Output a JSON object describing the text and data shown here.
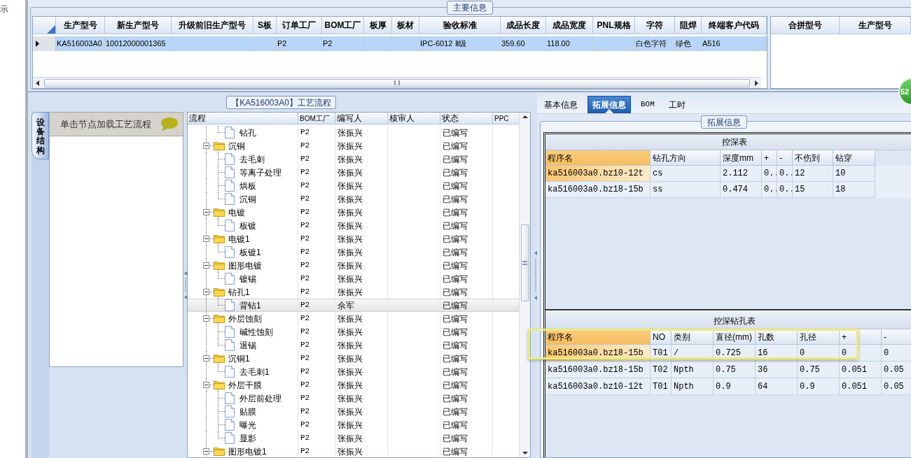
{
  "edge_text": "示",
  "main_info": {
    "legend": "主要信息",
    "columns": [
      "生产型号",
      "新生产型号",
      "升级前旧生产型号",
      "S板",
      "订单工厂",
      "BOM工厂",
      "板厚",
      "板材",
      "验收标准",
      "成品长度",
      "成品宽度",
      "PNL规格",
      "字符",
      "阻焊",
      "终端客户代码"
    ],
    "rows": [
      {
        "selected": true,
        "cells": [
          "KA516003A0",
          "10012000001365",
          null,
          null,
          "P2",
          "P2",
          null,
          null,
          "IPC-6012 Ⅱ级",
          "359.60",
          "118.00",
          null,
          "白色字符",
          "绿色",
          "A516"
        ]
      }
    ]
  },
  "merge_grid": {
    "columns": [
      "合拼型号",
      "生产型号"
    ]
  },
  "badge": "52",
  "flow_panel": {
    "legend": "【KA516003A0】工艺流程",
    "side_tab": "设备结构",
    "hint": "单击节点加载工艺流程",
    "columns": [
      "流程",
      "BOM工厂",
      "编写人",
      "核审人",
      "状态",
      "PPC"
    ],
    "nodes": [
      {
        "children": [
          {
            "kind": "file",
            "label": "钻孔",
            "bom": "P2",
            "author": "张振兴",
            "status": "已编写",
            "selected": false
          }
        ]
      },
      {
        "kind": "folder",
        "label": "沉铜",
        "bom": "P2",
        "author": "张振兴",
        "status": "已编写",
        "expanded": true,
        "selected": false,
        "children": [
          {
            "kind": "file",
            "label": "去毛刺",
            "bom": "P2",
            "author": "张振兴",
            "status": "已编写",
            "selected": false
          },
          {
            "kind": "file",
            "label": "等离子处理",
            "bom": "P2",
            "author": "张振兴",
            "status": "已编写",
            "selected": false
          },
          {
            "kind": "file",
            "label": "烘板",
            "bom": "P2",
            "author": "张振兴",
            "status": "已编写",
            "selected": false
          },
          {
            "kind": "file",
            "label": "沉铜",
            "bom": "P2",
            "author": "张振兴",
            "status": "已编写",
            "selected": false
          }
        ]
      },
      {
        "kind": "folder",
        "label": "电镀",
        "bom": "P2",
        "author": "张振兴",
        "status": "已编写",
        "expanded": true,
        "selected": false,
        "children": [
          {
            "kind": "file",
            "label": "板镀",
            "bom": "P2",
            "author": "张振兴",
            "status": "已编写",
            "selected": false
          }
        ]
      },
      {
        "kind": "folder",
        "label": "电镀1",
        "bom": "P2",
        "author": "张振兴",
        "status": "已编写",
        "expanded": true,
        "selected": false,
        "children": [
          {
            "kind": "file",
            "label": "板镀1",
            "bom": "P2",
            "author": "张振兴",
            "status": "已编写",
            "selected": false
          }
        ]
      },
      {
        "kind": "folder",
        "label": "图形电镀",
        "bom": "P2",
        "author": "张振兴",
        "status": "已编写",
        "expanded": true,
        "selected": false,
        "children": [
          {
            "kind": "file",
            "label": "镀锡",
            "bom": "P2",
            "author": "张振兴",
            "status": "已编写",
            "selected": false
          }
        ]
      },
      {
        "kind": "folder",
        "label": "钻孔1",
        "bom": "P2",
        "author": "张振兴",
        "status": "已编写",
        "expanded": true,
        "selected": false,
        "children": [
          {
            "kind": "file",
            "label": "背钻1",
            "bom": "P2",
            "author": "佘军",
            "status": "已编写",
            "selected": true
          }
        ]
      },
      {
        "kind": "folder",
        "label": "外层蚀刻",
        "bom": "P2",
        "author": "张振兴",
        "status": "已编写",
        "expanded": true,
        "selected": false,
        "children": [
          {
            "kind": "file",
            "label": "碱性蚀刻",
            "bom": "P2",
            "author": "张振兴",
            "status": "已编写",
            "selected": false
          },
          {
            "kind": "file",
            "label": "退锡",
            "bom": "P2",
            "author": "张振兴",
            "status": "已编写",
            "selected": false
          }
        ]
      },
      {
        "kind": "folder",
        "label": "沉铜1",
        "bom": "P2",
        "author": "张振兴",
        "status": "已编写",
        "expanded": true,
        "selected": false,
        "children": [
          {
            "kind": "file",
            "label": "去毛刺1",
            "bom": "P2",
            "author": "张振兴",
            "status": "已编写",
            "selected": false
          }
        ]
      },
      {
        "kind": "folder",
        "label": "外层干膜",
        "bom": "P2",
        "author": "张振兴",
        "status": "已编写",
        "expanded": true,
        "selected": false,
        "children": [
          {
            "kind": "file",
            "label": "外层前处理",
            "bom": "P2",
            "author": "张振兴",
            "status": "已编写",
            "selected": false
          },
          {
            "kind": "file",
            "label": "贴膜",
            "bom": "P2",
            "author": "张振兴",
            "status": "已编写",
            "selected": false
          },
          {
            "kind": "file",
            "label": "曝光",
            "bom": "P2",
            "author": "张振兴",
            "status": "已编写",
            "selected": false
          },
          {
            "kind": "file",
            "label": "显影",
            "bom": "P2",
            "author": "张振兴",
            "status": "已编写",
            "selected": false
          }
        ]
      },
      {
        "kind": "folder",
        "label": "图形电镀1",
        "bom": "P2",
        "author": "张振兴",
        "status": "已编写",
        "expanded": true,
        "selected": false
      }
    ]
  },
  "detail_panel": {
    "tabs": [
      {
        "label": "基本信息",
        "selected": false
      },
      {
        "label": "拓展信息",
        "selected": true
      },
      {
        "label": "BOM",
        "selected": false
      },
      {
        "label": "工时",
        "selected": false
      }
    ],
    "legend": "拓展信息",
    "depth_table": {
      "title": "控深表",
      "columns": [
        {
          "label": "程序名",
          "selected": true
        },
        {
          "label": "钻孔方向",
          "selected": false
        },
        {
          "label": "深度mm",
          "selected": false
        },
        {
          "label": "+",
          "selected": false
        },
        {
          "label": "-",
          "selected": false
        },
        {
          "label": "不伤到",
          "selected": false
        },
        {
          "label": "钻穿",
          "selected": false
        }
      ],
      "rows": [
        {
          "selected": true,
          "cells": [
            "ka516003a0.bz10-12t",
            "cs",
            "2.112",
            "0..",
            "0..",
            "12",
            "10"
          ]
        },
        {
          "selected": false,
          "cells": [
            "ka516003a0.bz18-15b",
            "ss",
            "0.474",
            "0..",
            "0..",
            "15",
            "18"
          ]
        }
      ]
    },
    "drill_table": {
      "title": "控深钻孔表",
      "callout_frame": true,
      "columns": [
        {
          "label": "程序名",
          "selected": true
        },
        {
          "label": "NO",
          "selected": false
        },
        {
          "label": "类别",
          "selected": false
        },
        {
          "label": "直径(mm)",
          "selected": false
        },
        {
          "label": "孔数",
          "selected": false
        },
        {
          "label": "孔径",
          "selected": false
        },
        {
          "label": "+",
          "selected": false
        },
        {
          "label": "-",
          "selected": false
        }
      ],
      "rows": [
        {
          "selected": true,
          "cells": [
            "ka516003a0.bz18-15b",
            "T01",
            "/",
            "0.725",
            "16",
            "0",
            "0",
            "0"
          ]
        },
        {
          "selected": false,
          "cells": [
            "ka516003a0.bz18-15b",
            "T02",
            "Npth",
            "0.75",
            "36",
            "0.75",
            "0.051",
            "0.05"
          ]
        },
        {
          "selected": false,
          "cells": [
            "ka516003a0.bz10-12t",
            "T01",
            "Npth",
            "0.9",
            "64",
            "0.9",
            "0.051",
            "0.05"
          ]
        }
      ]
    }
  }
}
